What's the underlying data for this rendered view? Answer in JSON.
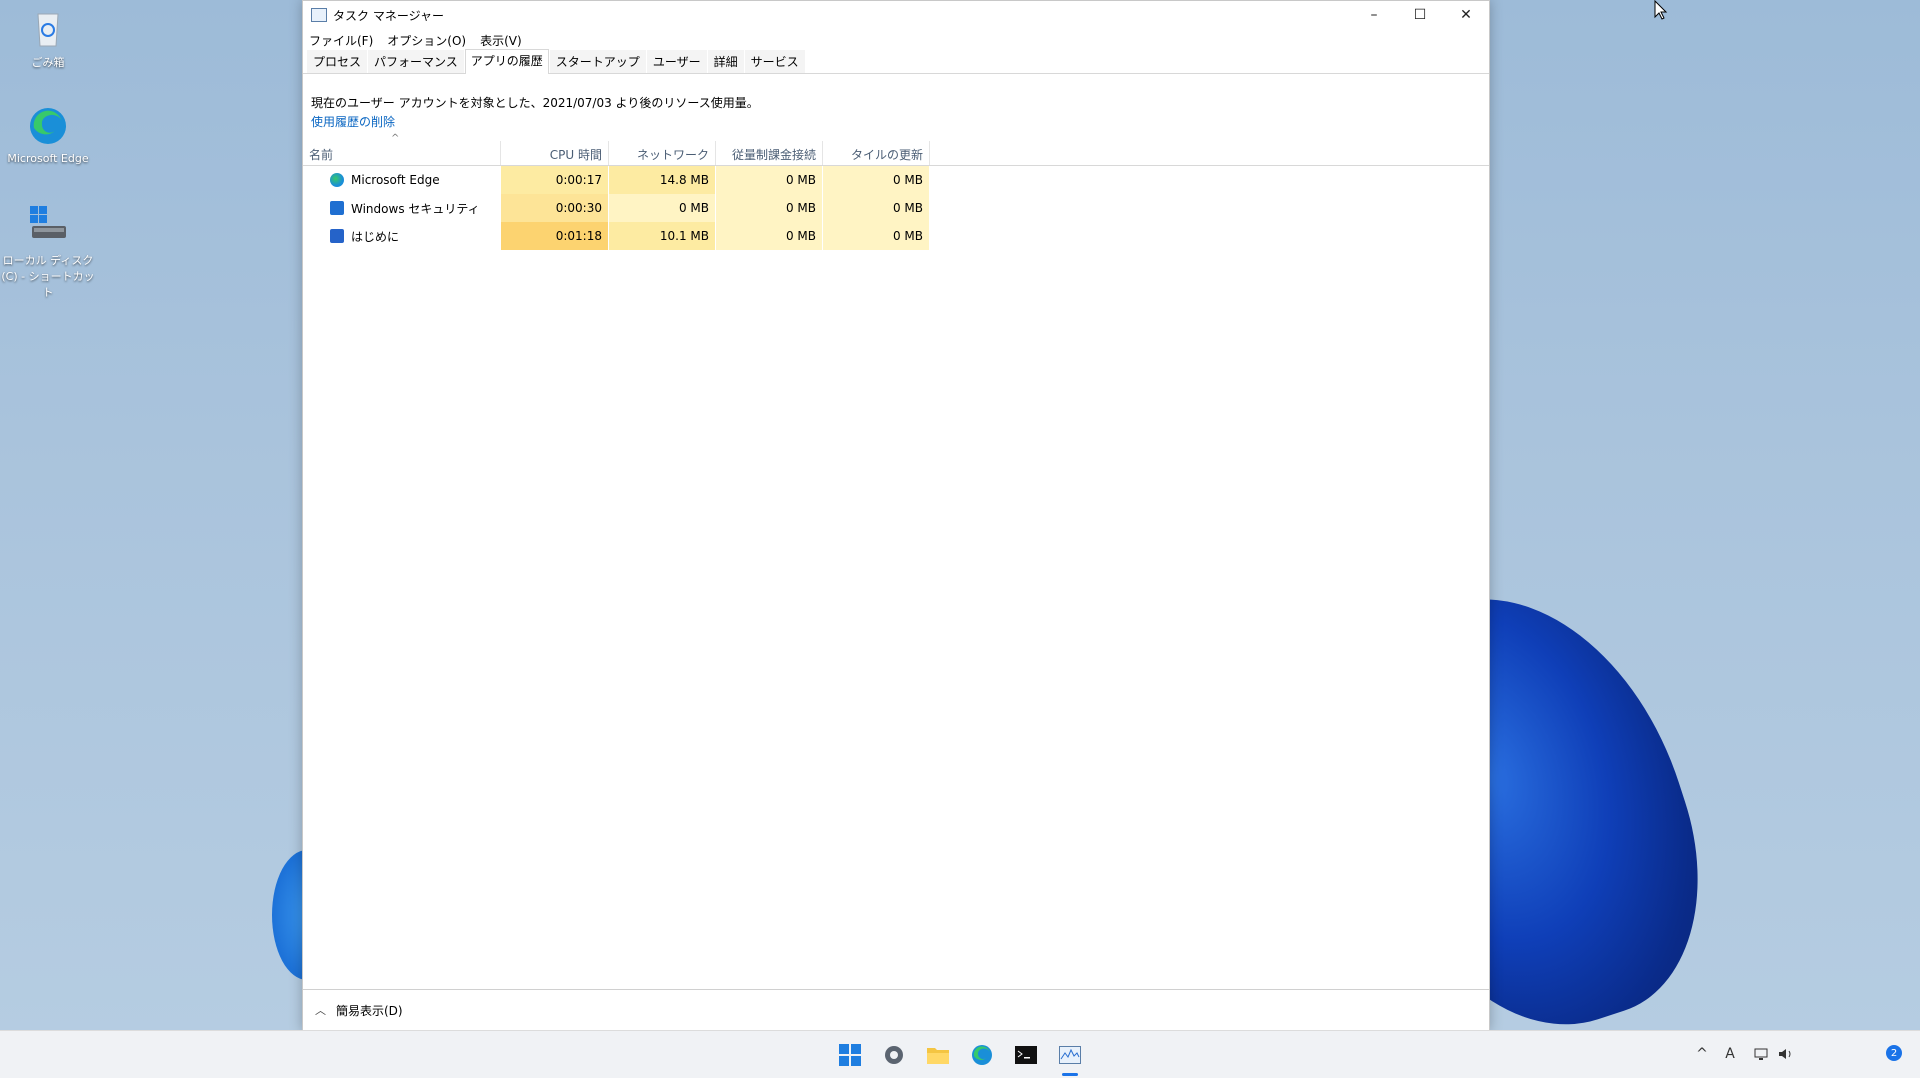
{
  "desktop": {
    "icons": [
      {
        "label": "ごみ箱"
      },
      {
        "label": "Microsoft Edge"
      },
      {
        "label": "ローカル ディスク (C) - ショートカット"
      }
    ]
  },
  "window": {
    "title": "タスク マネージャー",
    "controls": {
      "minimize": "–",
      "maximize": "☐",
      "close": "✕"
    },
    "menu": [
      "ファイル(F)",
      "オプション(O)",
      "表示(V)"
    ],
    "tabs": [
      "プロセス",
      "パフォーマンス",
      "アプリの履歴",
      "スタートアップ",
      "ユーザー",
      "詳細",
      "サービス"
    ],
    "active_tab": "アプリの履歴",
    "info_text": "現在のユーザー アカウントを対象とした、2021/07/03 より後のリソース使用量。",
    "delete_history_link": "使用履歴の削除",
    "columns": [
      "名前",
      "CPU 時間",
      "ネットワーク",
      "従量制課金接続",
      "タイルの更新"
    ],
    "rows": [
      {
        "name": "Microsoft Edge",
        "icon": "edge-icon",
        "cpu": "0:00:17",
        "network": "14.8 MB",
        "metered": "0 MB",
        "tile": "0 MB"
      },
      {
        "name": "Windows セキュリティ",
        "icon": "windows-security-icon",
        "cpu": "0:00:30",
        "network": "0 MB",
        "metered": "0 MB",
        "tile": "0 MB"
      },
      {
        "name": "はじめに",
        "icon": "get-started-icon",
        "cpu": "0:01:18",
        "network": "10.1 MB",
        "metered": "0 MB",
        "tile": "0 MB"
      }
    ],
    "heat_colors": {
      "cpu": [
        "#fdeba2",
        "#fde497",
        "#fcd370"
      ],
      "network": [
        "#fdeba2",
        "#fff4c4",
        "#fdeba2"
      ],
      "metered": [
        "#fff4c4",
        "#fff4c4",
        "#fff4c4"
      ],
      "tile": [
        "#fff4c4",
        "#fff4c4",
        "#fff4c4"
      ]
    },
    "footer_label": "簡易表示(D)"
  },
  "taskbar": {
    "apps": [
      "start-icon",
      "settings-icon",
      "file-explorer-icon",
      "edge-icon",
      "terminal-icon",
      "task-manager-icon"
    ],
    "tray_ime": "A",
    "notification_count": "2"
  }
}
